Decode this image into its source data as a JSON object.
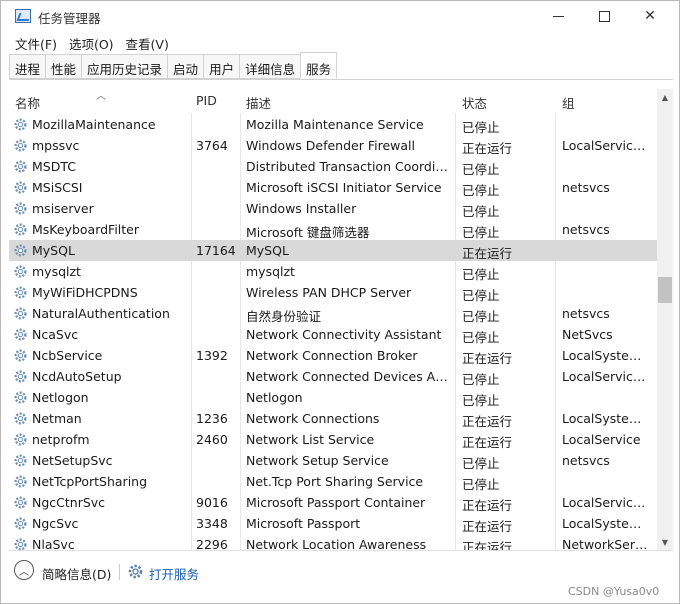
{
  "window": {
    "title": "任务管理器"
  },
  "menu": [
    "文件(F)",
    "选项(O)",
    "查看(V)"
  ],
  "tabs": [
    "进程",
    "性能",
    "应用历史记录",
    "启动",
    "用户",
    "详细信息",
    "服务"
  ],
  "active_tab": "服务",
  "columns": {
    "name": "名称",
    "pid": "PID",
    "desc": "描述",
    "status": "状态",
    "group": "组"
  },
  "rows": [
    {
      "name": "MozillaMaintenance",
      "pid": "",
      "desc": "Mozilla Maintenance Service",
      "status": "已停止",
      "group": ""
    },
    {
      "name": "mpssvc",
      "pid": "3764",
      "desc": "Windows Defender Firewall",
      "status": "正在运行",
      "group": "LocalService..."
    },
    {
      "name": "MSDTC",
      "pid": "",
      "desc": "Distributed Transaction Coordina...",
      "status": "已停止",
      "group": ""
    },
    {
      "name": "MSiSCSI",
      "pid": "",
      "desc": "Microsoft iSCSI Initiator Service",
      "status": "已停止",
      "group": "netsvcs"
    },
    {
      "name": "msiserver",
      "pid": "",
      "desc": "Windows Installer",
      "status": "已停止",
      "group": ""
    },
    {
      "name": "MsKeyboardFilter",
      "pid": "",
      "desc": "Microsoft 键盘筛选器",
      "status": "已停止",
      "group": "netsvcs"
    },
    {
      "name": "MySQL",
      "pid": "17164",
      "desc": "MySQL",
      "status": "正在运行",
      "group": "",
      "selected": true
    },
    {
      "name": "mysqlzt",
      "pid": "",
      "desc": "mysqlzt",
      "status": "已停止",
      "group": ""
    },
    {
      "name": "MyWiFiDHCPDNS",
      "pid": "",
      "desc": "Wireless PAN DHCP Server",
      "status": "已停止",
      "group": ""
    },
    {
      "name": "NaturalAuthentication",
      "pid": "",
      "desc": "自然身份验证",
      "status": "已停止",
      "group": "netsvcs"
    },
    {
      "name": "NcaSvc",
      "pid": "",
      "desc": "Network Connectivity Assistant",
      "status": "已停止",
      "group": "NetSvcs"
    },
    {
      "name": "NcbService",
      "pid": "1392",
      "desc": "Network Connection Broker",
      "status": "正在运行",
      "group": "LocalSystem..."
    },
    {
      "name": "NcdAutoSetup",
      "pid": "",
      "desc": "Network Connected Devices Aut...",
      "status": "已停止",
      "group": "LocalService..."
    },
    {
      "name": "Netlogon",
      "pid": "",
      "desc": "Netlogon",
      "status": "已停止",
      "group": ""
    },
    {
      "name": "Netman",
      "pid": "1236",
      "desc": "Network Connections",
      "status": "正在运行",
      "group": "LocalSystem..."
    },
    {
      "name": "netprofm",
      "pid": "2460",
      "desc": "Network List Service",
      "status": "正在运行",
      "group": "LocalService"
    },
    {
      "name": "NetSetupSvc",
      "pid": "",
      "desc": "Network Setup Service",
      "status": "已停止",
      "group": "netsvcs"
    },
    {
      "name": "NetTcpPortSharing",
      "pid": "",
      "desc": "Net.Tcp Port Sharing Service",
      "status": "已停止",
      "group": ""
    },
    {
      "name": "NgcCtnrSvc",
      "pid": "9016",
      "desc": "Microsoft Passport Container",
      "status": "正在运行",
      "group": "LocalService..."
    },
    {
      "name": "NgcSvc",
      "pid": "3348",
      "desc": "Microsoft Passport",
      "status": "正在运行",
      "group": "LocalSystem..."
    },
    {
      "name": "NlaSvc",
      "pid": "2296",
      "desc": "Network Location Awareness",
      "status": "正在运行",
      "group": "NetworkServ..."
    }
  ],
  "footer": {
    "collapse_label": "简略信息(D)",
    "open_services": "打开服务"
  },
  "watermark": "CSDN @Yusa0v0",
  "colors": {
    "selected_row": "#d9d9d9",
    "link": "#1a5fb4"
  },
  "icons": {
    "app": "task-manager-icon",
    "service": "gear-icon",
    "collapse": "chevron-up-icon",
    "open_services": "services-gear-icon"
  }
}
